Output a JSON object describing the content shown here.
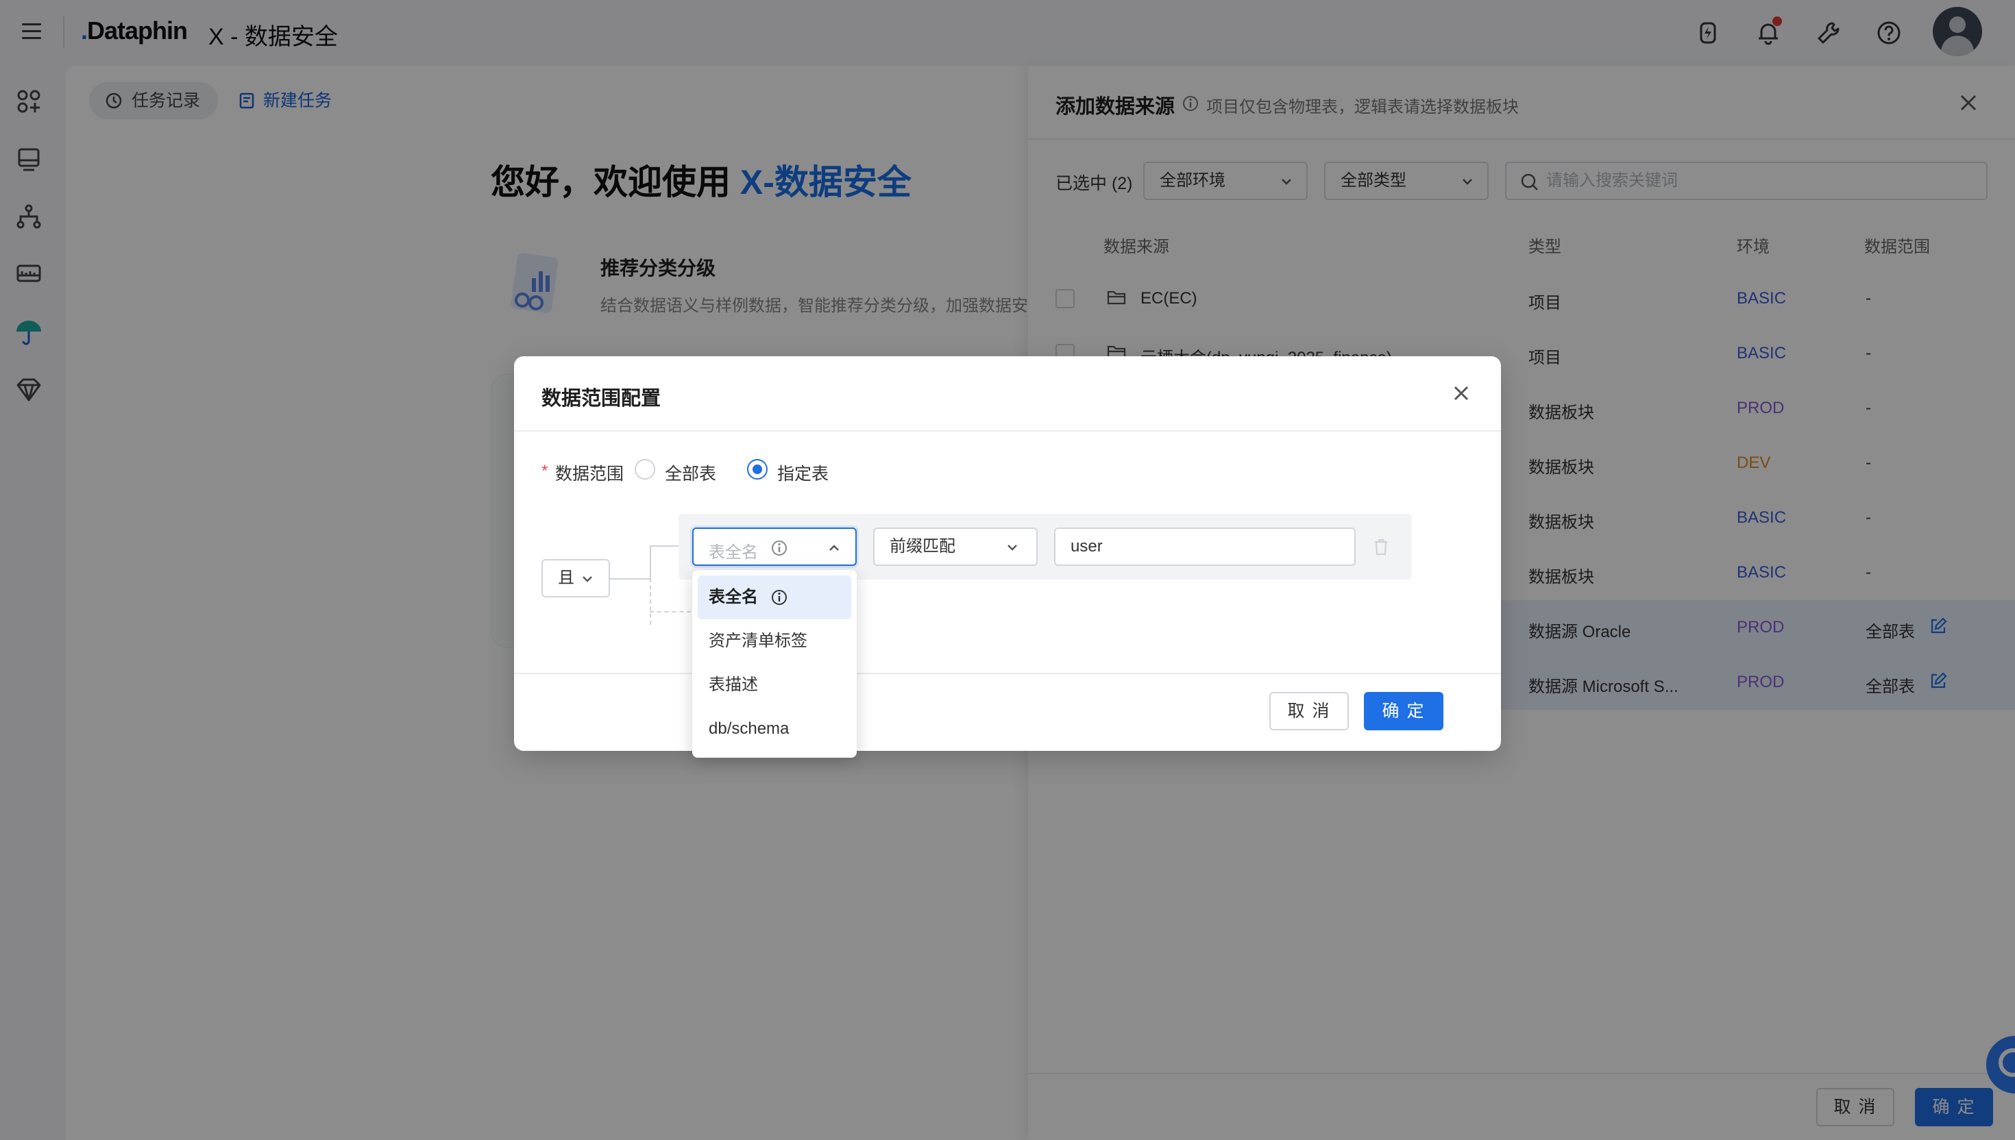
{
  "header": {
    "brand": "Dataphin",
    "app_title": "X - 数据安全"
  },
  "main": {
    "task_history": "任务记录",
    "new_task": "新建任务",
    "welcome_prefix": "您好，欢迎使用 ",
    "welcome_accent": "X-数据安全",
    "recommend_title": "推荐分类分级",
    "recommend_desc": "结合数据语义与样例数据，智能推荐分类分级，加强数据安"
  },
  "drawer": {
    "title": "添加数据来源",
    "hint": "项目仅包含物理表，逻辑表请选择数据板块",
    "selected": "已选中 (2)",
    "env_filter": "全部环境",
    "type_filter": "全部类型",
    "search_placeholder": "请输入搜索关键词",
    "columns": [
      "数据来源",
      "类型",
      "环境",
      "数据范围"
    ],
    "rows": [
      {
        "name": "EC(EC)",
        "type": "项目",
        "env": "BASIC",
        "range": "-"
      },
      {
        "name": "云栖大会(dp_yunqi_2025_finance)",
        "type": "项目",
        "env": "BASIC",
        "range": "-"
      },
      {
        "name": "",
        "type": "数据板块",
        "env": "PROD",
        "range": "-"
      },
      {
        "name": "",
        "type": "数据板块",
        "env": "DEV",
        "range": "-"
      },
      {
        "name": "",
        "type": "数据板块",
        "env": "BASIC",
        "range": "-"
      },
      {
        "name": "",
        "type": "数据板块",
        "env": "BASIC",
        "range": "-"
      },
      {
        "name": "",
        "type": "数据源  Oracle",
        "env": "PROD",
        "range": "全部表"
      },
      {
        "name": "",
        "type": "数据源  Microsoft S...",
        "env": "PROD",
        "range": "全部表"
      }
    ],
    "cancel": "取 消",
    "confirm": "确 定"
  },
  "modal": {
    "title": "数据范围配置",
    "field_label": "数据范围",
    "radio_all": "全部表",
    "radio_specified": "指定表",
    "logic_op": "且",
    "field_placeholder": "表全名",
    "match_type": "前缀匹配",
    "value": "user",
    "options": [
      "表全名",
      "资产清单标签",
      "表描述",
      "db/schema"
    ],
    "cancel": "取 消",
    "confirm": "确 定"
  },
  "colors": {
    "primary": "#1f6fe5",
    "env_basic": "#3b5bd6",
    "env_prod": "#8b59d6",
    "env_dev": "#e08a1e"
  }
}
